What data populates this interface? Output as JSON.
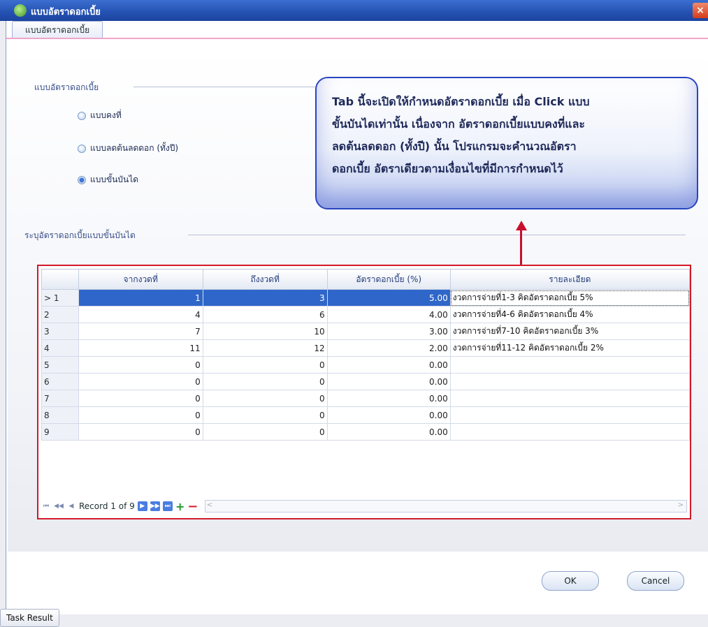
{
  "window": {
    "title": "แบบอัตราดอกเบี้ย",
    "close": "×"
  },
  "tab": {
    "label": "แบบอัตราดอกเบี้ย"
  },
  "rate_group": {
    "title": "แบบอัตราดอกเบี้ย",
    "options": [
      {
        "label": "แบบคงที่",
        "selected": false
      },
      {
        "label": "แบบลดต้นลดดอก (ทั้งปี)",
        "selected": false
      },
      {
        "label": "แบบขั้นบันได",
        "selected": true
      }
    ]
  },
  "callout": {
    "lines": [
      "Tab นี้จะเปิดให้กำหนดอัตราดอกเบี้ย เมื่อ Click แบบ",
      "ขั้นบันไดเท่านั้น เนื่องจาก อัตราดอกเบี้ยแบบคงที่และ",
      "ลดต้นลดดอก (ทั้งปี) นั้น โปรแกรมจะคำนวณอัตรา",
      "ดอกเบี้ย  อัตราเดียวตามเงื่อนไขที่มีการกำหนดไว้"
    ]
  },
  "grid_group": {
    "title": "ระบุอัตราดอกเบี้ยแบบขั้นบันได"
  },
  "grid": {
    "headers": [
      "",
      "จากงวดที่",
      "ถึงงวดที่",
      "อัตราดอกเบี้ย (%)",
      "รายละเอียด"
    ],
    "rows": [
      {
        "idx": "> 1",
        "from": "1",
        "to": "3",
        "rate": "5.00",
        "desc": "งวดการจ่ายที่1-3 คิดอัตราดอกเบี้ย 5%"
      },
      {
        "idx": "2",
        "from": "4",
        "to": "6",
        "rate": "4.00",
        "desc": "งวดการจ่ายที่4-6 คิดอัตราดอกเบี้ย 4%"
      },
      {
        "idx": "3",
        "from": "7",
        "to": "10",
        "rate": "3.00",
        "desc": "งวดการจ่ายที่7-10 คิดอัตราดอกเบี้ย 3%"
      },
      {
        "idx": "4",
        "from": "11",
        "to": "12",
        "rate": "2.00",
        "desc": "งวดการจ่ายที่11-12 คิดอัตราดอกเบี้ย 2%"
      },
      {
        "idx": "5",
        "from": "0",
        "to": "0",
        "rate": "0.00",
        "desc": ""
      },
      {
        "idx": "6",
        "from": "0",
        "to": "0",
        "rate": "0.00",
        "desc": ""
      },
      {
        "idx": "7",
        "from": "0",
        "to": "0",
        "rate": "0.00",
        "desc": ""
      },
      {
        "idx": "8",
        "from": "0",
        "to": "0",
        "rate": "0.00",
        "desc": ""
      },
      {
        "idx": "9",
        "from": "0",
        "to": "0",
        "rate": "0.00",
        "desc": ""
      }
    ],
    "selected_row": 0,
    "record_text": "Record 1 of 9"
  },
  "buttons": {
    "ok": "OK",
    "cancel": "Cancel"
  },
  "taskbar": {
    "label": "Task Result"
  },
  "colors": {
    "accent": "#2f66c9",
    "highlight_border": "#d11a2a",
    "title_bar": "#2451b1"
  }
}
